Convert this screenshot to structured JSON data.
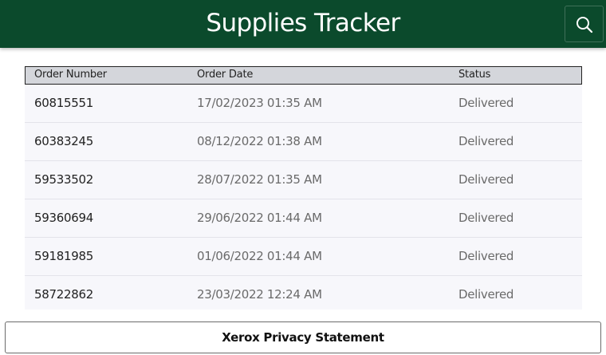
{
  "header": {
    "title": "Supplies Tracker",
    "search_icon": "search-icon"
  },
  "table": {
    "columns": [
      "Order Number",
      "Order Date",
      "Status"
    ],
    "rows": [
      {
        "order_number": "60815551",
        "order_date": "17/02/2023 01:35 AM",
        "status": "Delivered"
      },
      {
        "order_number": "60383245",
        "order_date": "08/12/2022 01:38 AM",
        "status": "Delivered"
      },
      {
        "order_number": "59533502",
        "order_date": "28/07/2022 01:35 AM",
        "status": "Delivered"
      },
      {
        "order_number": "59360694",
        "order_date": "29/06/2022 01:44 AM",
        "status": "Delivered"
      },
      {
        "order_number": "59181985",
        "order_date": "01/06/2022 01:44 AM",
        "status": "Delivered"
      },
      {
        "order_number": "58722862",
        "order_date": "23/03/2022 12:24 AM",
        "status": "Delivered"
      }
    ]
  },
  "footer": {
    "privacy_label": "Xerox Privacy Statement"
  },
  "colors": {
    "header_bg": "#0b4a2c",
    "table_header_bg": "#d4d6db",
    "row_bg": "#f7f7fb"
  }
}
